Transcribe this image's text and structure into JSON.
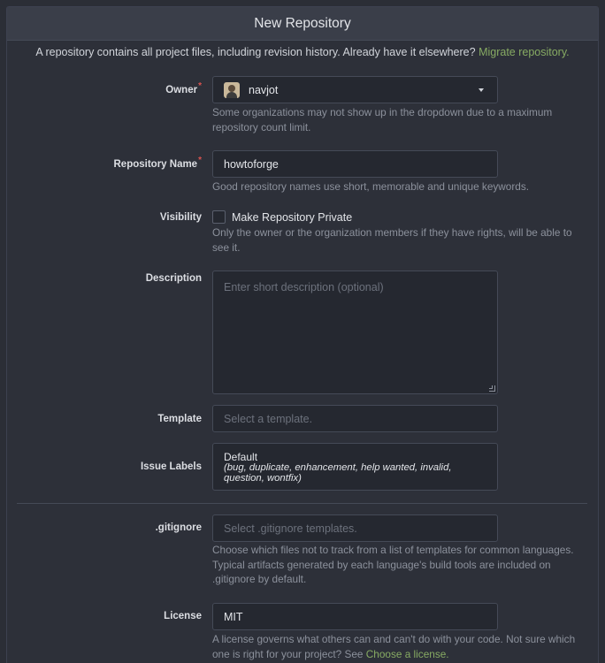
{
  "header": {
    "title": "New Repository"
  },
  "intro": {
    "text": "A repository contains all project files, including revision history. Already have it elsewhere?",
    "link": "Migrate repository."
  },
  "owner": {
    "label": "Owner",
    "required_mark": "*",
    "value": "navjot",
    "help": "Some organizations may not show up in the dropdown due to a maximum repository count limit."
  },
  "repo_name": {
    "label": "Repository Name",
    "required_mark": "*",
    "value": "howtoforge",
    "help": "Good repository names use short, memorable and unique keywords."
  },
  "visibility": {
    "label": "Visibility",
    "checkbox_label": "Make Repository Private",
    "checked": false,
    "help": "Only the owner or the organization members if they have rights, will be able to see it."
  },
  "description": {
    "label": "Description",
    "placeholder": "Enter short description (optional)"
  },
  "template": {
    "label": "Template",
    "placeholder": "Select a template."
  },
  "issue_labels": {
    "label": "Issue Labels",
    "value": "Default",
    "detail": "(bug, duplicate, enhancement, help wanted, invalid, question, wontfix)"
  },
  "gitignore": {
    "label": ".gitignore",
    "placeholder": "Select .gitignore templates.",
    "help": "Choose which files not to track from a list of templates for common languages. Typical artifacts generated by each language's build tools are included on .gitignore by default."
  },
  "license": {
    "label": "License",
    "value": "MIT",
    "help": "A license governs what others can and can't do with your code. Not sure which one is right for your project? See",
    "link": "Choose a license."
  },
  "colors": {
    "accent_link": "#87ab63",
    "required": "#d9534f",
    "panel_bg": "#2d3039",
    "input_bg": "#252830"
  }
}
